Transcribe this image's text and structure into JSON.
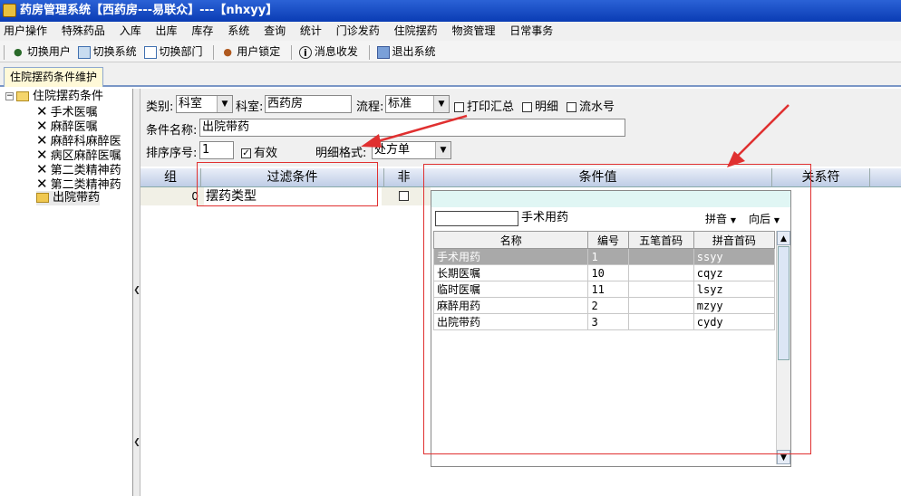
{
  "window": {
    "title": "药房管理系统【西药房---易联众】---【nhxyy】"
  },
  "menu": [
    "用户操作",
    "特殊药品",
    "入库",
    "出库",
    "库存",
    "系统",
    "查询",
    "统计",
    "门诊发药",
    "住院摆药",
    "物资管理",
    "日常事务"
  ],
  "toolbar": [
    {
      "label": "切换用户",
      "icon": "users-icon"
    },
    {
      "label": "切换系统",
      "icon": "switch-system-icon"
    },
    {
      "label": "切换部门",
      "icon": "department-icon"
    },
    {
      "label": "用户锁定",
      "icon": "user-lock-icon"
    },
    {
      "label": "消息收发",
      "icon": "info-icon"
    },
    {
      "label": "退出系统",
      "icon": "exit-icon"
    }
  ],
  "tab": {
    "label": "住院摆药条件维护"
  },
  "tree": {
    "root": "住院摆药条件",
    "children": [
      "手术医嘱",
      "麻醉医嘱",
      "麻醉科麻醉医",
      "病区麻醉医嘱",
      "第二类精神药",
      "第二类精神药",
      "出院带药"
    ]
  },
  "form": {
    "category_label": "类别:",
    "category_value": "科室",
    "dept_label": "科室:",
    "dept_value": "西药房",
    "flow_label": "流程:",
    "flow_value": "标准",
    "print_summary": "打印汇总",
    "detail": "明细",
    "serial": "流水号",
    "cond_name_label": "条件名称:",
    "cond_name_value": "出院带药",
    "sort_label": "排序序号:",
    "sort_value": "1",
    "valid_label": "有效",
    "valid_checked": true,
    "detail_format_label": "明细格式:",
    "detail_format_value": "处方单"
  },
  "grid": {
    "headers": [
      "组",
      "过滤条件",
      "非",
      "条件值",
      "关系符"
    ],
    "row": {
      "group": "0",
      "filter": "摆药类型"
    }
  },
  "popup": {
    "current_value": "手术用药",
    "pinyin": "拼音",
    "direction": "向后",
    "columns": [
      "名称",
      "编号",
      "五笔首码",
      "拼音首码"
    ],
    "rows": [
      {
        "name": "手术用药",
        "code": "1",
        "wubi": "",
        "pinyin": "ssyy"
      },
      {
        "name": "长期医嘱",
        "code": "10",
        "wubi": "",
        "pinyin": "cqyz"
      },
      {
        "name": "临时医嘱",
        "code": "11",
        "wubi": "",
        "pinyin": "lsyz"
      },
      {
        "name": "麻醉用药",
        "code": "2",
        "wubi": "",
        "pinyin": "mzyy"
      },
      {
        "name": "出院带药",
        "code": "3",
        "wubi": "",
        "pinyin": "cydy"
      }
    ]
  },
  "colors": {
    "annotation": "#e03030",
    "selected_row": "#a9a9a9",
    "title_bar": "#0a3cb4"
  }
}
